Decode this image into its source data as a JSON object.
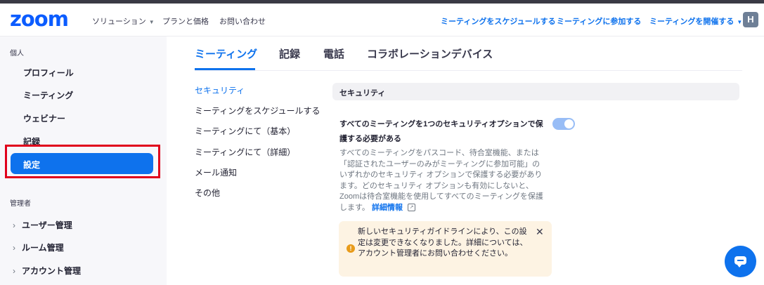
{
  "header": {
    "logo": "zoom",
    "nav_left": [
      {
        "label": "ソリューション",
        "has_caret": true
      },
      {
        "label": "プランと価格",
        "has_caret": false
      },
      {
        "label": "お問い合わせ",
        "has_caret": false
      }
    ],
    "nav_right": [
      {
        "label": "ミーティングをスケジュールする"
      },
      {
        "label": "ミーティングに参加する"
      },
      {
        "label": "ミーティングを開催する",
        "has_caret": true
      }
    ],
    "avatar_initial": "H"
  },
  "sidebar": {
    "personal_title": "個人",
    "personal_items": [
      {
        "label": "プロフィール"
      },
      {
        "label": "ミーティング"
      },
      {
        "label": "ウェビナー"
      },
      {
        "label": "記録"
      },
      {
        "label": "設定",
        "active": true
      }
    ],
    "admin_title": "管理者",
    "admin_items": [
      {
        "label": "ユーザー管理"
      },
      {
        "label": "ルーム管理"
      },
      {
        "label": "アカウント管理"
      }
    ]
  },
  "tabs": [
    {
      "label": "ミーティング",
      "active": true
    },
    {
      "label": "記録"
    },
    {
      "label": "電話"
    },
    {
      "label": "コラボレーションデバイス"
    }
  ],
  "subnav": [
    {
      "label": "セキュリティ",
      "active": true
    },
    {
      "label": "ミーティングをスケジュールする"
    },
    {
      "label": "ミーティングにて（基本）"
    },
    {
      "label": "ミーティングにて（詳細）"
    },
    {
      "label": "メール通知"
    },
    {
      "label": "その他"
    }
  ],
  "section": {
    "header": "セキュリティ",
    "setting_title": "すべてのミーティングを1つのセキュリティオプションで保護する必要がある",
    "toggle_on": true,
    "description": "すべてのミーティングをパスコード、待合室機能、または「認証されたユーザーのみがミーティングに参加可能」のいずれかのセキュリティ オプションで保護する必要があります。どのセキュリティ オプションも有効にしないと、Zoomは待合室機能を使用してすべてのミーティングを保護します。",
    "link_text": "詳細情報",
    "notice": "新しいセキュリティガイドラインにより、この設定は変更できなくなりました。詳細については、アカウント管理者にお問い合わせください。"
  },
  "colors": {
    "accent": "#0e72ed",
    "highlight_border": "#e0001b",
    "notice_bg": "#fdf3e3",
    "warning": "#e89b1a"
  },
  "icons": [
    "caret-down-icon",
    "chevron-right-icon",
    "close-icon",
    "warning-icon",
    "external-link-icon",
    "chat-icon"
  ]
}
